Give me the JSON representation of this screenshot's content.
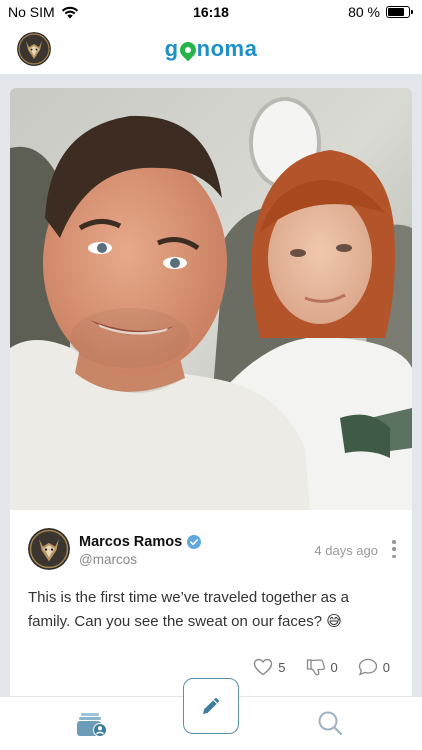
{
  "status_bar": {
    "carrier": "No SIM",
    "time": "16:18",
    "battery_percent_label": "80 %",
    "battery_level": 0.8,
    "wifi_icon": "wifi-icon",
    "battery_icon": "battery-icon"
  },
  "header": {
    "logo_part_1": "g",
    "logo_part_2": "noma",
    "avatar_icon": "wolf-avatar"
  },
  "post": {
    "photo_icon": "selfie-photo",
    "author_name": "Marcos Ramos",
    "author_handle": "@marcos",
    "verified_icon": "verified-badge-icon",
    "time_ago": "4 days ago",
    "text": "This is the first time we’ve traveled together as a family. Can you see the sweat on our faces? 😅",
    "likes": "5",
    "dislikes": "0",
    "comments": "0"
  },
  "nav": {
    "feed_icon": "feed-profile-icon",
    "compose_icon": "pencil-icon",
    "search_icon": "search-icon"
  },
  "colors": {
    "brand_blue": "#1f8fc9",
    "brand_green": "#27b54a",
    "feed_background": "#e3e7ec",
    "nav_icon": "#5c8ea8",
    "verified": "#5fa8e0"
  }
}
